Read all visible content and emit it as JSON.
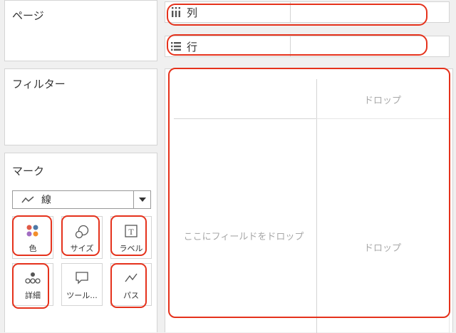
{
  "left_panel": {
    "pages": {
      "title": "ページ"
    },
    "filters": {
      "title": "フィルター"
    },
    "marks": {
      "title": "マーク",
      "mark_type": {
        "label": "線",
        "icon": "line-chart-icon"
      },
      "buttons": [
        {
          "label": "色",
          "icon": "color-dots-icon",
          "highlighted": true
        },
        {
          "label": "サイズ",
          "icon": "size-circles-icon",
          "highlighted": true
        },
        {
          "label": "ラベル",
          "icon": "label-t-icon",
          "highlighted": true
        },
        {
          "label": "詳細",
          "icon": "detail-dots-icon",
          "highlighted": true
        },
        {
          "label": "ツール...",
          "icon": "tooltip-icon",
          "highlighted": false
        },
        {
          "label": "パス",
          "icon": "path-line-icon",
          "highlighted": true
        }
      ]
    }
  },
  "shelves": {
    "columns": {
      "label": "列",
      "icon": "columns-icon"
    },
    "rows": {
      "label": "行",
      "icon": "rows-icon"
    }
  },
  "view": {
    "drop_top": "ドロップ",
    "drop_field": "ここにフィールドをドロップ",
    "drop_main": "ドロップ"
  },
  "colors": {
    "highlight": "#e5321c",
    "border": "#d4d4d4",
    "placeholder_text": "#a8a8a8",
    "dot_red": "#e05a47",
    "dot_blue": "#4e79a7",
    "dot_purple": "#a26dc2",
    "dot_orange": "#f28e2b"
  }
}
